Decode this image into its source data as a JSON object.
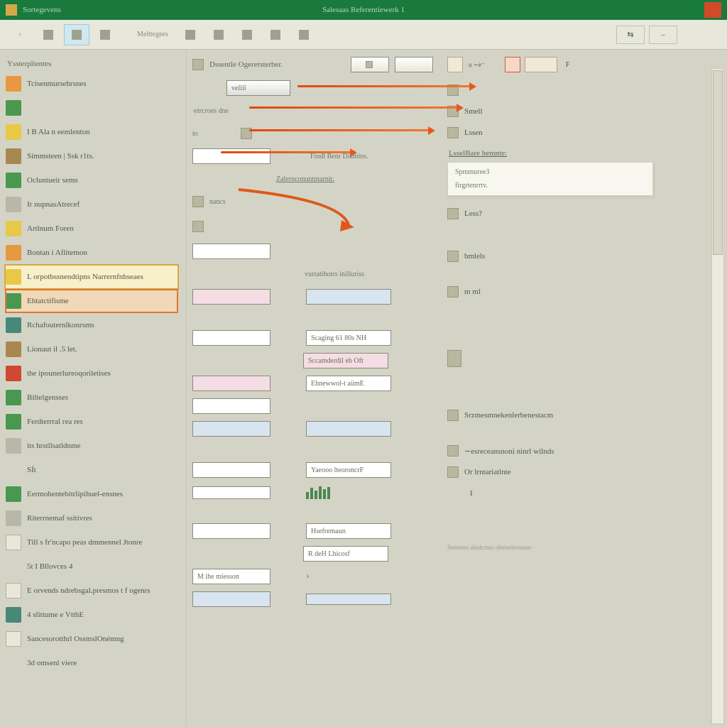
{
  "titlebar": {
    "title": "Sortegevens",
    "center": "Salesaas Referentiewerk 1"
  },
  "toolbar": {
    "back": "‹",
    "tab1": "Melttegees",
    "right1": "⇆",
    "right2": "–"
  },
  "left": {
    "heading": "Yssterplientes",
    "items": [
      {
        "label": "Tcisenmursehrsnes",
        "icon": "ora"
      },
      {
        "label": "",
        "icon": "grn"
      },
      {
        "label": "I B Ala n eemlenton",
        "icon": "yel"
      },
      {
        "label": "Simmsteen | Ssk r1ts.",
        "icon": "brn"
      },
      {
        "label": "Ocluntueir sems",
        "icon": "grn"
      },
      {
        "label": "Ir nupnasAtrecef",
        "icon": "gry"
      },
      {
        "label": "Artlnum Foren",
        "icon": "yel"
      },
      {
        "label": "Bontan i Aflitemon",
        "icon": "ora"
      },
      {
        "label": "L orpotbssnendtipns Narrernfnbseaes",
        "icon": "yel",
        "sel": 2
      },
      {
        "label": "Ehtatctifisme",
        "icon": "grn",
        "sel": 1
      },
      {
        "label": "Rchafouternlkonrsms",
        "icon": "teal"
      },
      {
        "label": "Lionaut il .5 let.",
        "icon": "brn"
      },
      {
        "label": "the ipounerlureoqoriletises",
        "icon": "red"
      },
      {
        "label": "Biltelgensses",
        "icon": "grn"
      },
      {
        "label": "Ferdterrral rea res",
        "icon": "grn"
      },
      {
        "label": "its hrstllsatldnme",
        "icon": "gry"
      },
      {
        "label": "SÍt",
        "icon": ""
      },
      {
        "label": "Eermohentebitrlipihuel-ensnes",
        "icon": "grn"
      },
      {
        "label": "Riterrnemaf ssitivres",
        "icon": "gry"
      },
      {
        "label": "Till s fr′ncapo peas  dmmennel Jtonre",
        "icon": "wht"
      },
      {
        "label": "5t I Bllovces 4",
        "icon": ""
      },
      {
        "label": "E orvends ndrebsgal.presmos  t f ogenrs",
        "icon": "wht"
      },
      {
        "label": "4 slittume e VtthE",
        "icon": "teal"
      },
      {
        "label": "Sancesorotthrl OssmslOnémng",
        "icon": "wht"
      },
      {
        "label": "3d omsenl viere",
        "icon": ""
      }
    ]
  },
  "mid": {
    "heading": "Dssentle Ogerersterber.",
    "topbtn": "veliil",
    "lbl_enter": "∙etrcroes dne",
    "lbl_to": "to",
    "lbl_findtoe": "Findl Benr Diamins.",
    "lbl_zahrn": "Zalernconuntmarnir.",
    "lbl_nancs": "nancs",
    "lbl_vurrat": "vurratihotrs inilluriss",
    "f_scaging": "Scaging 61 80s  NH",
    "f_sconder": "Sccamderdil eb Oft",
    "f_ehnew": "Ehnewwol-t aümE",
    "f_yaeooo": "Yaeooo lteoroncrF",
    "f_hsef": "Hsefremaun",
    "f_rdel": "R deH   Lhicosf",
    "f_mihe": "M ihe  miesson",
    "bottom_arrow": "›"
  },
  "right": {
    "small1": "∙a ∼e⁻",
    "small2": "F",
    "lbl_smell": "Smell",
    "lbl_lssen": "Lssen",
    "heading": "LsselBare hemnte:",
    "opt1": "Spmmuree3",
    "opt2": "firgrtenrrtv.",
    "lbl_less": "Less?",
    "lbl_bmlels": "bmlels",
    "lbl_mml": "m ml",
    "row1": "Srzmesmnekenlerbenestacm",
    "row2": "∼esreceansnoni ninrl  wilnds",
    "row3": "Or lrntariatlnte",
    "row4": "I",
    "foot": "Sresrees abnlcrnrs obetsrieouase-"
  }
}
